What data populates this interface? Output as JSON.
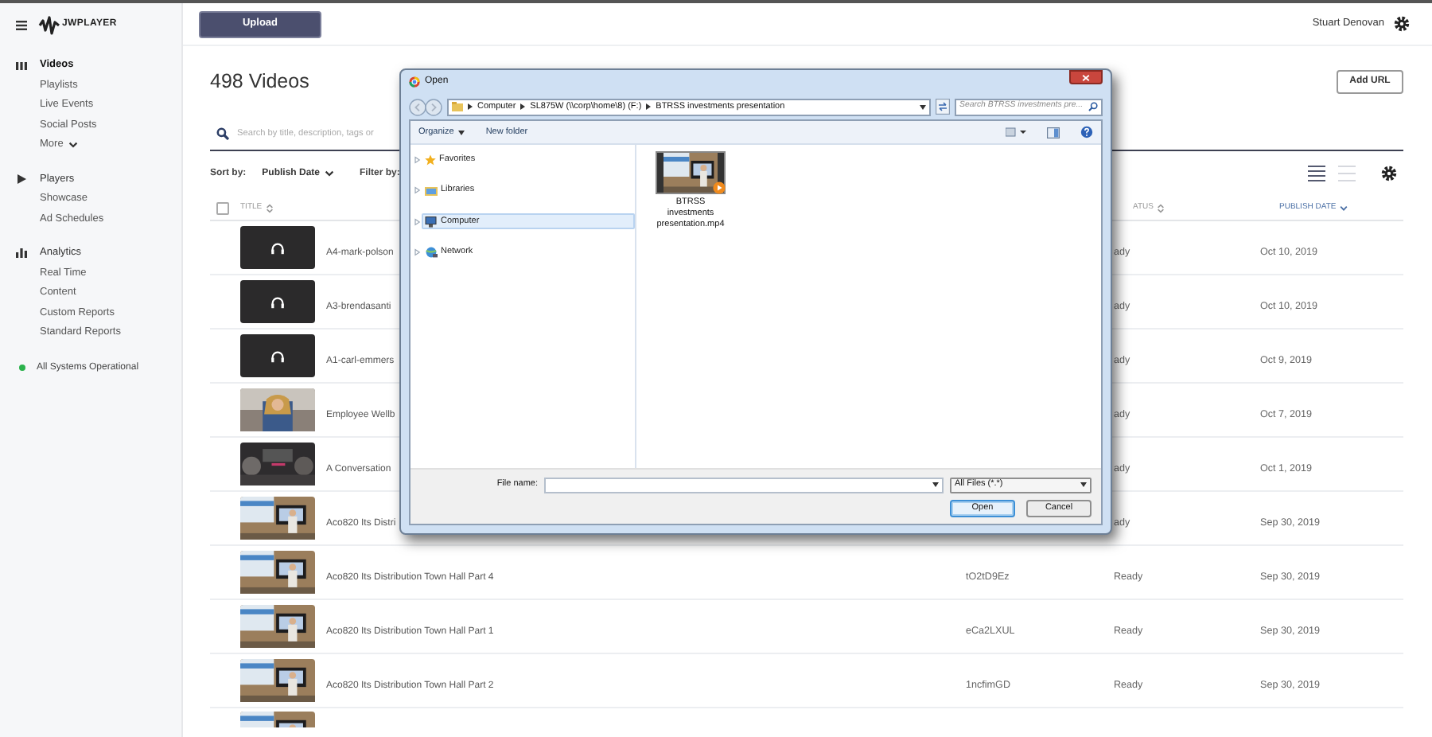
{
  "app": {
    "logo": "JWPLAYER"
  },
  "topbar": {
    "upload": "Upload",
    "user": "Stuart Denovan"
  },
  "sidebar": {
    "sections": [
      {
        "kind": "videos",
        "label": "Videos",
        "selected": true,
        "items": [
          {
            "label": "Playlists",
            "selected": false
          },
          {
            "label": "Live Events",
            "selected": false
          },
          {
            "label": "Social Posts",
            "selected": false
          },
          {
            "label": "More",
            "selected": false,
            "dropdown": true
          }
        ]
      },
      {
        "kind": "players",
        "label": "Players",
        "selected": false,
        "items": [
          {
            "label": "Showcase",
            "selected": false
          },
          {
            "label": "Ad Schedules",
            "selected": false
          }
        ]
      },
      {
        "kind": "analytics",
        "label": "Analytics",
        "selected": false,
        "items": [
          {
            "label": "Real Time",
            "selected": false
          },
          {
            "label": "Content",
            "selected": false
          },
          {
            "label": "Custom Reports",
            "selected": false
          },
          {
            "label": "Standard Reports",
            "selected": false
          }
        ]
      }
    ],
    "status": {
      "label": "All Systems Operational",
      "color": "#2bb24c"
    }
  },
  "page": {
    "title": "498 Videos",
    "add_url": "Add URL",
    "search": {
      "placeholder": "Search by title, description, tags or"
    },
    "sort": {
      "label": "Sort by:",
      "value": "Publish Date"
    },
    "filter": {
      "label": "Filter by:"
    },
    "views": [
      {
        "kind": "list",
        "selected": true
      },
      {
        "kind": "compact",
        "selected": false
      }
    ]
  },
  "table": {
    "select_all": {
      "checked": false
    },
    "columns": [
      {
        "label": "TITLE",
        "kind": "sortable"
      },
      {
        "label": "ATUS",
        "kind": "sortable"
      },
      {
        "label": "PUBLISH DATE",
        "kind": "sorted"
      }
    ],
    "rows": [
      {
        "kind": "audio",
        "title": "A4-mark-polson",
        "status": "ady",
        "date": "Oct 10, 2019"
      },
      {
        "kind": "audio",
        "title": "A3-brendasanti",
        "status": "ady",
        "date": "Oct 10, 2019"
      },
      {
        "kind": "audio",
        "title": "A1-carl-emmers",
        "status": "ady",
        "date": "Oct 9, 2019"
      },
      {
        "kind": "video",
        "title": "Employee Wellb",
        "status": "ady",
        "date": "Oct 7, 2019"
      },
      {
        "kind": "video",
        "title": "A Conversation",
        "status": "ady",
        "date": "Oct 1, 2019"
      },
      {
        "kind": "video",
        "title": "Aco820 Its Distri",
        "status": "ady",
        "date": "Sep 30, 2019"
      },
      {
        "kind": "video",
        "title": "Aco820 Its Distribution Town Hall Part 4",
        "id": "tO2tD9Ez",
        "status": "Ready",
        "date": "Sep 30, 2019"
      },
      {
        "kind": "video",
        "title": "Aco820 Its Distribution Town Hall Part 1",
        "id": "eCa2LXUL",
        "status": "Ready",
        "date": "Sep 30, 2019"
      },
      {
        "kind": "video",
        "title": "Aco820 Its Distribution Town Hall Part 2",
        "id": "1ncfimGD",
        "status": "Ready",
        "date": "Sep 30, 2019"
      },
      {
        "kind": "video"
      }
    ]
  },
  "dialog": {
    "title": "Open",
    "path": [
      "Computer",
      "SL875W (\\\\corp\\home\\8) (F:)",
      "BTRSS investments presentation"
    ],
    "search": {
      "placeholder": "Search BTRSS investments pre..."
    },
    "toolbar": [
      {
        "label": "Organize",
        "dropdown": true
      },
      {
        "label": "New folder",
        "dropdown": false
      }
    ],
    "nav": [
      {
        "kind": "favorites",
        "label": "Favorites",
        "selected": false
      },
      {
        "kind": "libraries",
        "label": "Libraries",
        "selected": false
      },
      {
        "kind": "computer",
        "label": "Computer",
        "selected": true
      },
      {
        "kind": "network",
        "label": "Network",
        "selected": false
      }
    ],
    "files": [
      {
        "name": "BTRSS investments presentation.mp4"
      }
    ],
    "file_name_label": "File name:",
    "filter": "All Files (*.*)",
    "buttons": [
      {
        "label": "Open",
        "default": true
      },
      {
        "label": "Cancel",
        "default": false
      }
    ]
  }
}
